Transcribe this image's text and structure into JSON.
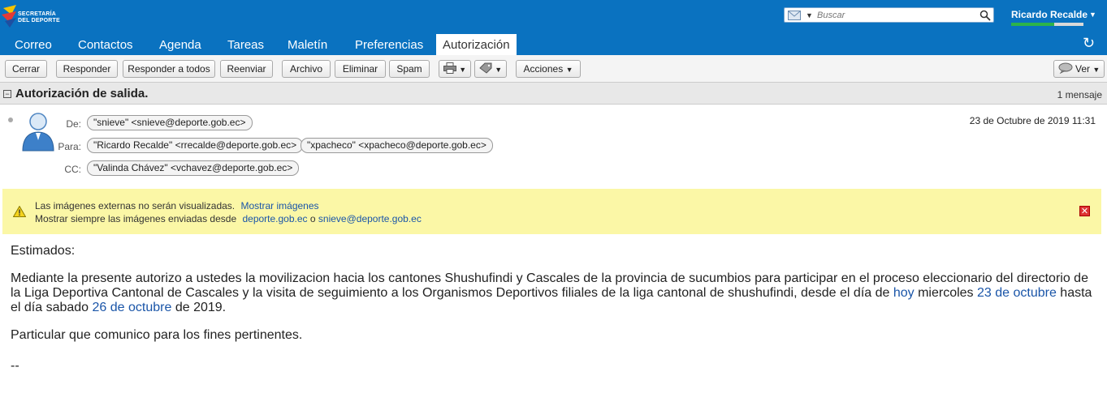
{
  "app": {
    "logo_line1": "SECRETARÍA",
    "logo_line2": "DEL DEPORTE",
    "search_placeholder": "Buscar",
    "user_name": "Ricardo Recalde",
    "quota_fraction": 0.6
  },
  "tabs": [
    {
      "label": "Correo"
    },
    {
      "label": "Contactos"
    },
    {
      "label": "Agenda"
    },
    {
      "label": "Tareas"
    },
    {
      "label": "Maletín"
    },
    {
      "label": "Preferencias"
    },
    {
      "label": "Autorización de"
    }
  ],
  "toolbar": {
    "close": "Cerrar",
    "reply": "Responder",
    "reply_all": "Responder a todos",
    "forward": "Reenviar",
    "archive": "Archivo",
    "delete": "Eliminar",
    "spam": "Spam",
    "actions": "Acciones",
    "view": "Ver"
  },
  "conversation": {
    "subject": "Autorización de salida.",
    "count": "1 mensaje"
  },
  "message": {
    "from_label": "De:",
    "to_label": "Para:",
    "cc_label": "CC:",
    "from": "\"snieve\" <snieve@deporte.gob.ec>",
    "to": [
      "\"Ricardo Recalde\" <rrecalde@deporte.gob.ec>",
      "\"xpacheco\" <xpacheco@deporte.gob.ec>"
    ],
    "cc": "\"Valinda Chávez\" <vchavez@deporte.gob.ec>",
    "date": "23 de Octubre de 2019 11:31"
  },
  "warning": {
    "line1": "Las imágenes externas no serán visualizadas.",
    "show_images": "Mostrar imágenes",
    "line2": "Mostrar siempre las imágenes enviadas desde",
    "domain": "deporte.gob.ec",
    "or": "o",
    "sender": "snieve@deporte.gob.ec"
  },
  "body": {
    "greeting": "Estimados:",
    "p1_a": "Mediante la presente autorizo a ustedes la movilizacion hacia los cantones Shushufindi y Cascales de la provincia de sucumbios para participar en el proceso eleccionario del directorio de la Liga Deportiva Cantonal de Cascales y la visita de seguimiento a los Organismos Deportivos filiales de la liga cantonal de shushufindi, desde el día de ",
    "p1_hoy": "hoy",
    "p1_b": " miercoles ",
    "p1_date1": "23 de octubre",
    "p1_c": " hasta el día sabado ",
    "p1_date2": "26 de octubre",
    "p1_d": " de 2019.",
    "closing": "Particular que comunico para los fines pertinentes.",
    "signature": "--"
  },
  "colors": {
    "header_blue": "#0a72c0",
    "warning_yellow": "#fbf7a6",
    "link": "#1a55a8"
  }
}
